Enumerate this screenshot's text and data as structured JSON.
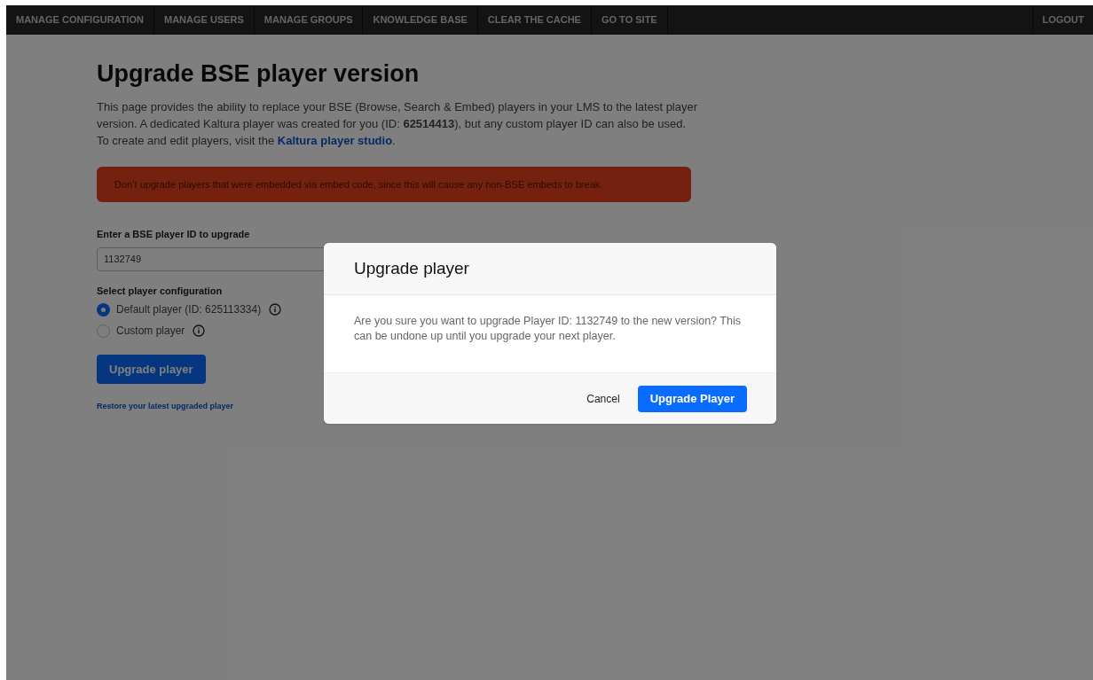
{
  "nav": {
    "items": [
      {
        "label": "MANAGE CONFIGURATION"
      },
      {
        "label": "MANAGE USERS"
      },
      {
        "label": "MANAGE GROUPS"
      },
      {
        "label": "KNOWLEDGE BASE"
      },
      {
        "label": "CLEAR THE CACHE"
      },
      {
        "label": "GO TO SITE"
      }
    ],
    "logout": "LOGOUT"
  },
  "page": {
    "title": "Upgrade BSE player version",
    "intro": "This page provides the ability to replace your BSE (Browse, Search & Embed) players in your LMS to the latest player version. A dedicated Kaltura player was created for you (ID: **62514413**), but any custom player ID can also be used. To create and edit players, visit the",
    "intro_link": "Kaltura player studio",
    "intro_end": ".",
    "warning": "Don’t upgrade players that were embedded via embed code, since this will cause any non-BSE embeds to break.",
    "id_field": {
      "label": "Enter a BSE player ID to upgrade",
      "value": "1132749"
    },
    "config": {
      "label": "Select player configuration",
      "options": [
        {
          "label": "Default player (ID: 625113334)",
          "selected": true
        },
        {
          "label": "Custom player",
          "selected": false
        }
      ]
    },
    "upgrade_button": "Upgrade player",
    "restore_link": "Restore your latest upgraded player"
  },
  "dialog": {
    "title": "Upgrade player",
    "message": "Are you sure you want to upgrade Player ID: 1132749 to the new version? This can be undone up until you upgrade your next player.",
    "cancel": "Cancel",
    "confirm": "Upgrade Player"
  }
}
